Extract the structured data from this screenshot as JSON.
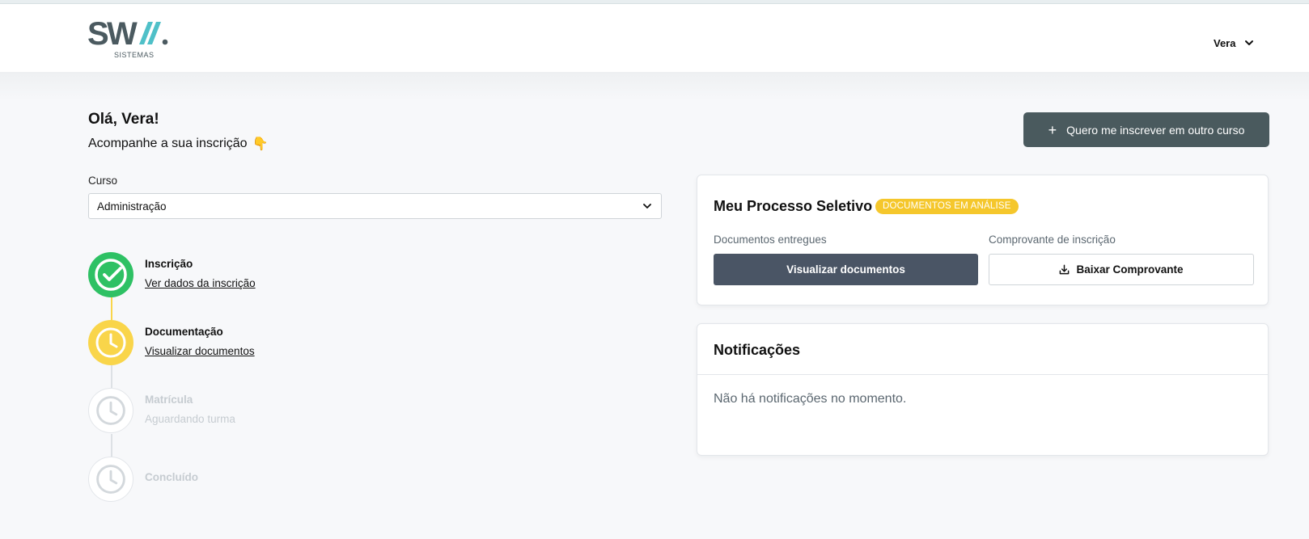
{
  "header": {
    "logo_text": "SWA.",
    "logo_sub": "SISTEMAS",
    "user_name": "Vera"
  },
  "greeting": {
    "title": "Olá, Vera!",
    "subtitle": "Acompanhe a sua inscrição",
    "emoji": "👇"
  },
  "actions": {
    "enroll_label": "Quero me inscrever em outro curso"
  },
  "course": {
    "label": "Curso",
    "selected": "Administração"
  },
  "steps": [
    {
      "title": "Inscrição",
      "subtitle": "Ver dados da inscrição",
      "status": "done"
    },
    {
      "title": "Documentação",
      "subtitle": "Visualizar documentos",
      "status": "in-progress"
    },
    {
      "title": "Matrícula",
      "subtitle": "Aguardando turma",
      "status": "pending"
    },
    {
      "title": "Concluído",
      "subtitle": "",
      "status": "pending"
    }
  ],
  "process": {
    "title": "Meu Processo Seletivo",
    "badge": "DOCUMENTOS EM ANÁLISE",
    "docs_label": "Documentos entregues",
    "docs_button": "Visualizar documentos",
    "receipt_label": "Comprovante de inscrição",
    "receipt_button": "Baixar Comprovante"
  },
  "notifications": {
    "title": "Notificações",
    "empty_text": "Não há notificações no momento."
  },
  "colors": {
    "success": "#2ec164",
    "warning": "#f9d54a",
    "badge": "#f5c72c",
    "primary_dark": "#4a5a5e",
    "button_dark": "#4a5565"
  }
}
